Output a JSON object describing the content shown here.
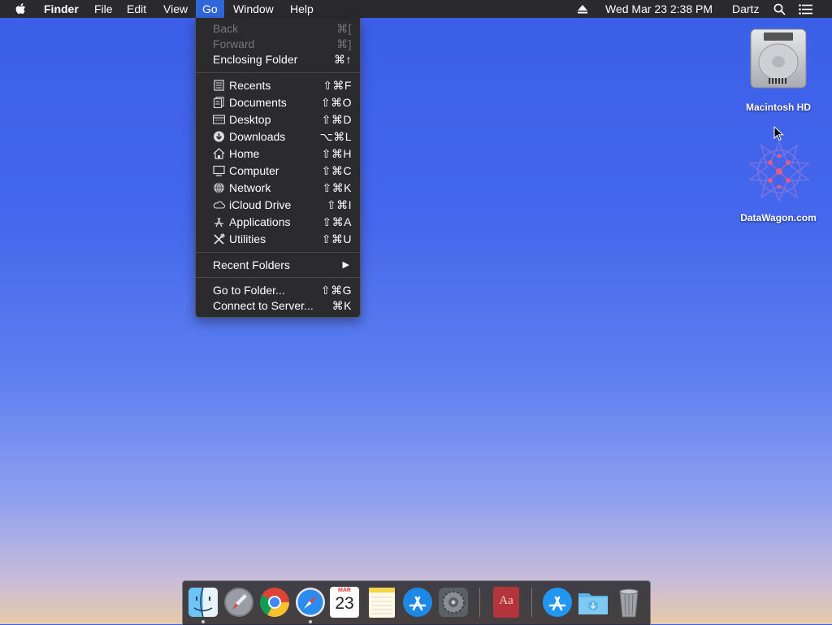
{
  "menubar": {
    "app_name": "Finder",
    "menus": [
      "File",
      "Edit",
      "View",
      "Go",
      "Window",
      "Help"
    ],
    "datetime": "Wed Mar 23  2:38 PM",
    "user": "Dartz"
  },
  "go_menu": {
    "items": [
      {
        "label": "Back",
        "shortcut": "⌘[",
        "enabled": false
      },
      {
        "label": "Forward",
        "shortcut": "⌘]",
        "enabled": false
      },
      {
        "label": "Enclosing Folder",
        "shortcut": "⌘↑",
        "enabled": true
      },
      {
        "label": "Recents",
        "shortcut": "⇧⌘F",
        "icon": "recents-icon"
      },
      {
        "label": "Documents",
        "shortcut": "⇧⌘O",
        "icon": "documents-icon"
      },
      {
        "label": "Desktop",
        "shortcut": "⇧⌘D",
        "icon": "desktop-icon"
      },
      {
        "label": "Downloads",
        "shortcut": "⌥⌘L",
        "icon": "downloads-icon"
      },
      {
        "label": "Home",
        "shortcut": "⇧⌘H",
        "icon": "home-icon"
      },
      {
        "label": "Computer",
        "shortcut": "⇧⌘C",
        "icon": "computer-icon"
      },
      {
        "label": "Network",
        "shortcut": "⇧⌘K",
        "icon": "network-icon"
      },
      {
        "label": "iCloud Drive",
        "shortcut": "⇧⌘I",
        "icon": "icloud-icon"
      },
      {
        "label": "Applications",
        "shortcut": "⇧⌘A",
        "icon": "applications-icon"
      },
      {
        "label": "Utilities",
        "shortcut": "⇧⌘U",
        "icon": "utilities-icon"
      },
      {
        "label": "Recent Folders",
        "submenu": true
      },
      {
        "label": "Go to Folder...",
        "shortcut": "⇧⌘G"
      },
      {
        "label": "Connect to Server...",
        "shortcut": "⌘K"
      }
    ]
  },
  "desktop": {
    "icons": [
      {
        "label": "Macintosh HD",
        "icon": "hard-drive-icon"
      },
      {
        "label": "DataWagon.com",
        "icon": "network-server-icon"
      }
    ]
  },
  "dock": {
    "apps": [
      "finder-icon",
      "launchpad-icon",
      "chrome-icon",
      "safari-icon",
      "calendar-icon",
      "notes-icon",
      "app-store-icon",
      "system-preferences-icon",
      "dictionary-icon",
      "applications-folder-icon",
      "downloads-folder-icon",
      "trash-icon"
    ],
    "calendar": {
      "month": "MAR",
      "day": "23"
    },
    "dictionary_label": "Aa"
  },
  "colors": {
    "menu_highlight": "#2f66d9",
    "menubar_bg": "#2a2a2c"
  }
}
